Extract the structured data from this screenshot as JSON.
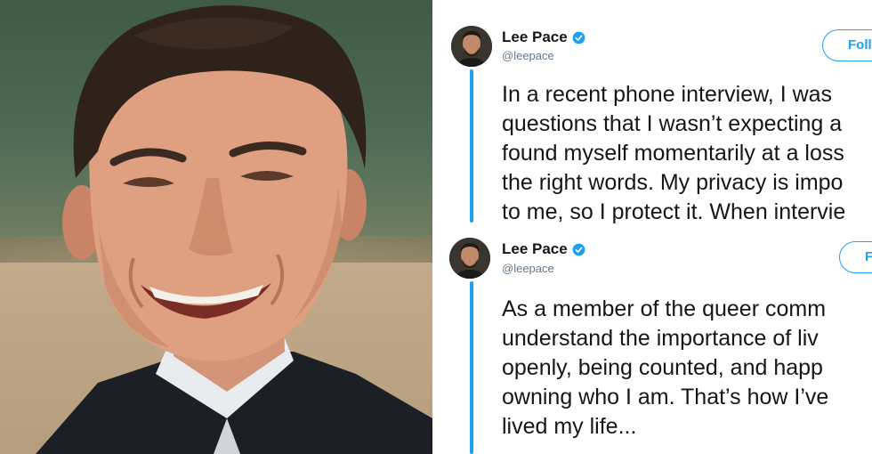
{
  "tweets": [
    {
      "name": "Lee Pace",
      "handle": "@leepace",
      "follow_label": "Follow",
      "verified": true,
      "lines": [
        "In a recent phone interview, I was",
        "questions that I wasn’t expecting a",
        "found myself momentarily at a loss",
        "the right words. My privacy is impo",
        "to me, so I protect it. When intervie"
      ]
    },
    {
      "name": "Lee Pace",
      "handle": "@leepace",
      "follow_label": "F",
      "verified": true,
      "lines": [
        "As a member of the queer comm",
        "understand the importance of liv",
        "openly, being counted, and happ",
        "owning who I am. That’s how I’ve",
        "lived my life..."
      ]
    }
  ],
  "colors": {
    "accent": "#1da1f2",
    "text": "#14171a",
    "muted": "#657786"
  },
  "icons": {
    "verified": "verified-badge-icon"
  }
}
